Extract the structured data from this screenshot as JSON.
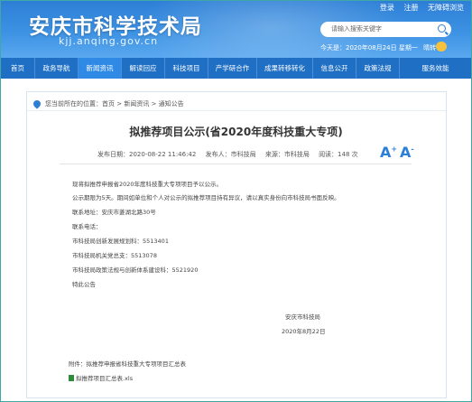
{
  "header": {
    "site_title": "安庆市科学技术局",
    "domain": "kjj.anqing.gov.cn",
    "top_links": [
      "登录",
      "注册",
      "无障碍浏览"
    ],
    "search_placeholder": "请输入搜索关键字",
    "date_line": "今天是：2020年08月24日 星期一",
    "weather_label": "晴转"
  },
  "nav": {
    "items": [
      "首页",
      "政务导航",
      "新闻资讯",
      "解读回应",
      "科技项目",
      "产学研合作",
      "成果转移转化",
      "信息公开",
      "政策法规",
      "服务效能"
    ],
    "active_index": 2
  },
  "breadcrumb": {
    "text": "您当前所在的位置：首页 > 新闻资讯 > 通知公告"
  },
  "article": {
    "title": "拟推荐项目公示(省2020年度科技重大专项)",
    "publish_time": "发布日期：2020-08-22 11:46:42",
    "author": "发布人：市科技局",
    "source": "来源：市科技局",
    "views": "阅读：148 次",
    "font_larger": "A",
    "font_smaller": "A",
    "paragraphs": [
      "现将拟推荐申报省2020年度科技重大专项项目予以公示。",
      "公示期限为5天。期间如单位和个人对公示的拟推荐项目持有异议，请以真实身份向市科技局书面反映。",
      "联系地址：安庆市菱湖北路30号",
      "联系电话：",
      "市科技局创新发展规划科：5513401",
      "市科技局机关党总支：5513078",
      "市科技局政策法规与创新体系建设科：5521920",
      "特此公告"
    ],
    "signature_org": "安庆市科技局",
    "signature_date": "2020年8月22日",
    "attachment_label": "附件：拟推荐申报省科技重大专项项目汇总表",
    "attachment_file": "拟推荐项目汇总表.xls"
  }
}
